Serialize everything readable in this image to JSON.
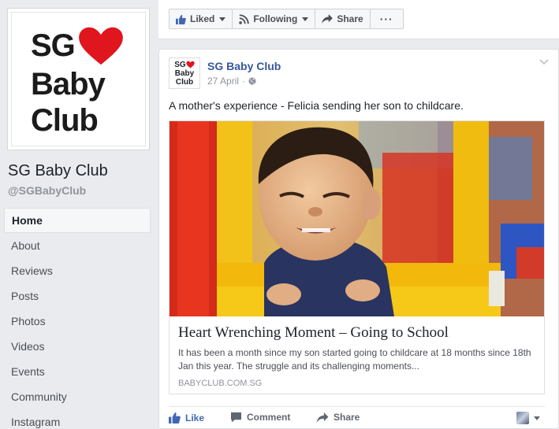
{
  "page": {
    "name": "SG Baby Club",
    "handle": "@SGBabyClub",
    "logo": {
      "line1": "SG",
      "line2": "Baby",
      "line3": "Club",
      "heart_color": "#e0161e"
    }
  },
  "nav": {
    "items": [
      {
        "label": "Home",
        "active": true
      },
      {
        "label": "About"
      },
      {
        "label": "Reviews"
      },
      {
        "label": "Posts"
      },
      {
        "label": "Photos"
      },
      {
        "label": "Videos"
      },
      {
        "label": "Events"
      },
      {
        "label": "Community"
      },
      {
        "label": "Instagram"
      }
    ]
  },
  "actionbar": {
    "liked_label": "Liked",
    "following_label": "Following",
    "share_label": "Share",
    "more_label": "···"
  },
  "post": {
    "author": "SG Baby Club",
    "date": "27 April",
    "separator": "·",
    "text": "A mother's experience - Felicia sending her son to childcare.",
    "link": {
      "title": "Heart Wrenching Moment – Going to School",
      "description": "It has been a month since my son started going to childcare at 18 months since 18th Jan this year. The struggle and its challenging moments...",
      "domain": "BABYCLUB.COM.SG"
    },
    "actions": {
      "like_label": "Like",
      "comment_label": "Comment",
      "share_label": "Share"
    }
  },
  "colors": {
    "link_blue": "#365899",
    "like_blue": "#4267b2",
    "background": "#e9ebee"
  },
  "icons": [
    "thumbs-up-icon",
    "rss-icon",
    "share-arrow-icon",
    "globe-icon",
    "chevron-down-icon",
    "comment-icon",
    "heart-icon"
  ]
}
